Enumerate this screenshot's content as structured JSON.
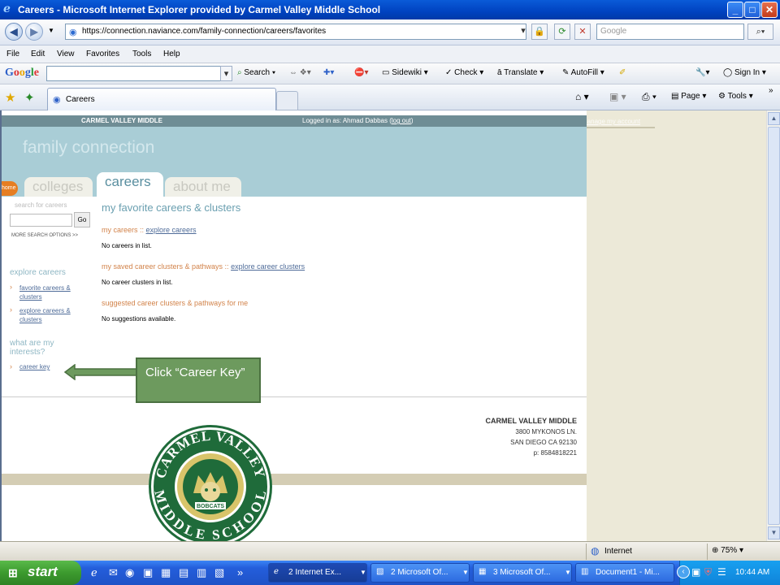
{
  "window": {
    "title": "Careers - Microsoft Internet Explorer provided by Carmel Valley Middle School",
    "minimize": "_",
    "maximize": "□",
    "close": "✕"
  },
  "address": {
    "url": "https://connection.naviance.com/family-connection/careers/favorites",
    "search_placeholder": "Google"
  },
  "menu": [
    "File",
    "Edit",
    "View",
    "Favorites",
    "Tools",
    "Help"
  ],
  "google_toolbar": {
    "logo": "Google",
    "items": [
      "Search",
      "Sidewiki",
      "Check",
      "Translate",
      "AutoFill"
    ],
    "sign_in": "Sign In"
  },
  "tabs_bar": {
    "tab_label": "Careers",
    "page_menu": "Page",
    "tools_menu": "Tools"
  },
  "page": {
    "school_header": "CARMEL VALLEY MIDDLE",
    "logged_in_prefix": "Logged in as: Ahmad Dabbas (",
    "logout": "log out",
    "logged_in_suffix": ")",
    "manage_account": "Manage my account",
    "brand": "family connection",
    "home_tab": "home",
    "nav_tabs": [
      "colleges",
      "careers",
      "about me"
    ],
    "search_label": "search for careers",
    "go": "Go",
    "more_search": "MORE SEARCH OPTIONS >>",
    "explore_heading": "explore careers",
    "side_links": [
      "favorite careers & clusters",
      "explore careers & clusters"
    ],
    "interests_heading": "what are my interests?",
    "career_key": "career key",
    "main_title": "my favorite careers & clusters",
    "my_careers": "my careers ::",
    "explore_careers_link": "explore careers",
    "no_careers": "No careers in list.",
    "saved_clusters": "my saved career clusters & pathways ::",
    "explore_clusters_link": "explore career clusters",
    "no_clusters": "No career clusters in list.",
    "suggested": "suggested career clusters & pathways for me",
    "no_suggestions": "No suggestions available.",
    "footer_school": "CARMEL VALLEY MIDDLE",
    "footer_address1": "3800 MYKONOS LN.",
    "footer_address2": "SAN DIEGO CA 92130",
    "footer_phone": "p: 8584818221",
    "seal_top": "CARMEL VALLEY",
    "seal_bottom": "MIDDLE SCHOOL",
    "seal_center": "BOBCATS"
  },
  "callout": {
    "text": "Click “Career Key”"
  },
  "status": {
    "zone": "Internet",
    "zoom": "75%"
  },
  "taskbar": {
    "start": "start",
    "tasks": [
      "2 Internet Ex...",
      "2 Microsoft Of...",
      "3 Microsoft Of...",
      "Document1 - Mi..."
    ],
    "clock": "10:44 AM"
  },
  "colors": {
    "accent": "#a9cdd6",
    "callout": "#6d9a5e",
    "seal_green": "#1f6b3a",
    "seal_gold": "#d8c46a"
  }
}
